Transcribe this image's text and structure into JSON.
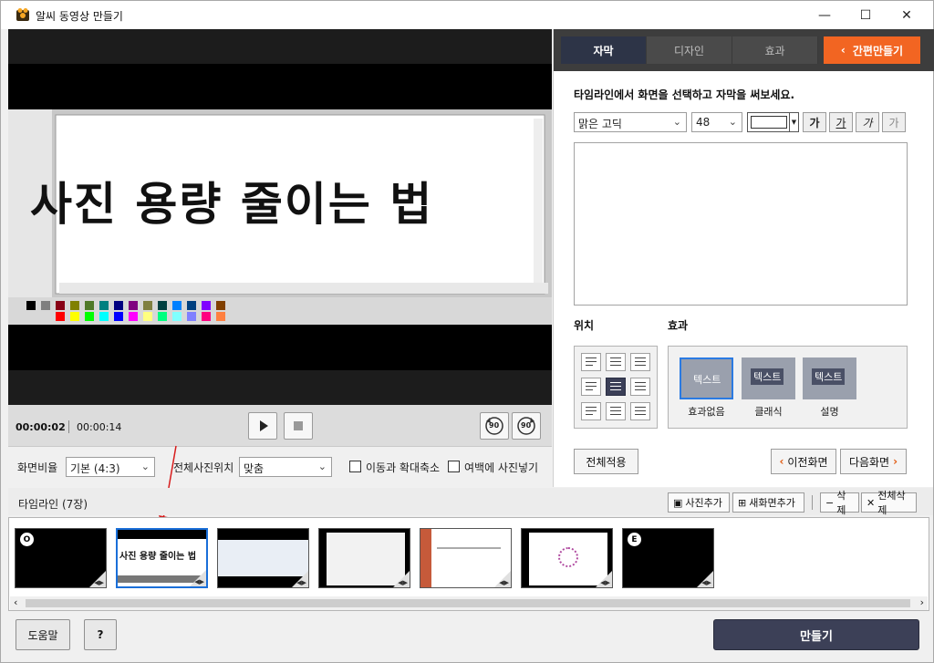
{
  "window": {
    "title": "알씨 동영상 만들기",
    "minimize": "—",
    "maximize": "☐",
    "close": "✕"
  },
  "preview": {
    "overlay_text": "사진 용량 줄이는 법"
  },
  "playback": {
    "current_time": "00:00:02",
    "total_time": "00:00:14",
    "rotate_right": "90",
    "rotate_left": "90"
  },
  "options": {
    "aspect_label": "화면비율",
    "aspect_value": "기본 (4:3)",
    "position_label": "전체사진위치",
    "position_value": "맞춤",
    "move_zoom_label": "이동과 확대축소",
    "margin_photo_label": "여백에 사진넣기"
  },
  "tabs": {
    "subtitle": "자막",
    "design": "디자인",
    "effect": "효과",
    "easy_make": "간편만들기"
  },
  "subtitle_panel": {
    "hint": "타임라인에서 화면을 선택하고 자막을 써보세요.",
    "font_value": "맑은 고딕",
    "size_value": "48",
    "bold_btn": "가",
    "underline_btn": "가",
    "italic_btn": "가",
    "outline_btn": "가",
    "position_header": "위치",
    "effect_header": "효과",
    "effect_chip": "텍스트",
    "effects": [
      "효과없음",
      "클래식",
      "설명"
    ],
    "apply_all": "전체적용",
    "prev_screen": "이전화면",
    "next_screen": "다음화면"
  },
  "timeline": {
    "title": "타임라인 (7장)",
    "add_photo": "사진추가",
    "new_screen": "새화면추가",
    "delete": "삭제",
    "delete_all": "전체삭제",
    "start_badge": "O",
    "end_badge": "E",
    "thumb2_text": "사진 용량 줄이는 법"
  },
  "bottom": {
    "help": "도움말",
    "question": "?",
    "make": "만들기"
  },
  "colors": {
    "accent_orange": "#f26522",
    "dark_navy": "#3c4057",
    "selection_blue": "#1a6fd9"
  }
}
